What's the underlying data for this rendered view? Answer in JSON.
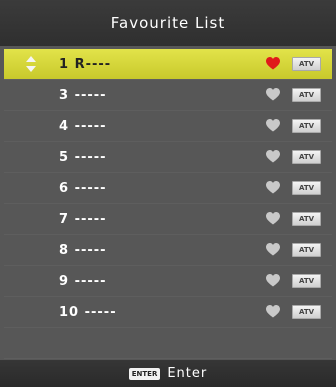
{
  "header": {
    "title": "Favourite List"
  },
  "channels": [
    {
      "label": "1  R----",
      "favourite": true,
      "type": "ATV",
      "selected": true
    },
    {
      "label": "3  -----",
      "favourite": false,
      "type": "ATV",
      "selected": false
    },
    {
      "label": "4  -----",
      "favourite": false,
      "type": "ATV",
      "selected": false
    },
    {
      "label": "5  -----",
      "favourite": false,
      "type": "ATV",
      "selected": false
    },
    {
      "label": "6  -----",
      "favourite": false,
      "type": "ATV",
      "selected": false
    },
    {
      "label": "7  -----",
      "favourite": false,
      "type": "ATV",
      "selected": false
    },
    {
      "label": "8  -----",
      "favourite": false,
      "type": "ATV",
      "selected": false
    },
    {
      "label": "9  -----",
      "favourite": false,
      "type": "ATV",
      "selected": false
    },
    {
      "label": "10  -----",
      "favourite": false,
      "type": "ATV",
      "selected": false
    }
  ],
  "footer": {
    "key_label": "ENTER",
    "action_label": "Enter"
  },
  "colors": {
    "selected_highlight": "#d8d93c",
    "favourite_heart": "#e0191a",
    "inactive_heart": "#c9c9c9",
    "panel_background": "#575757"
  },
  "icons": {
    "selection": "up-down-arrows-icon",
    "favourite": "heart-icon"
  }
}
